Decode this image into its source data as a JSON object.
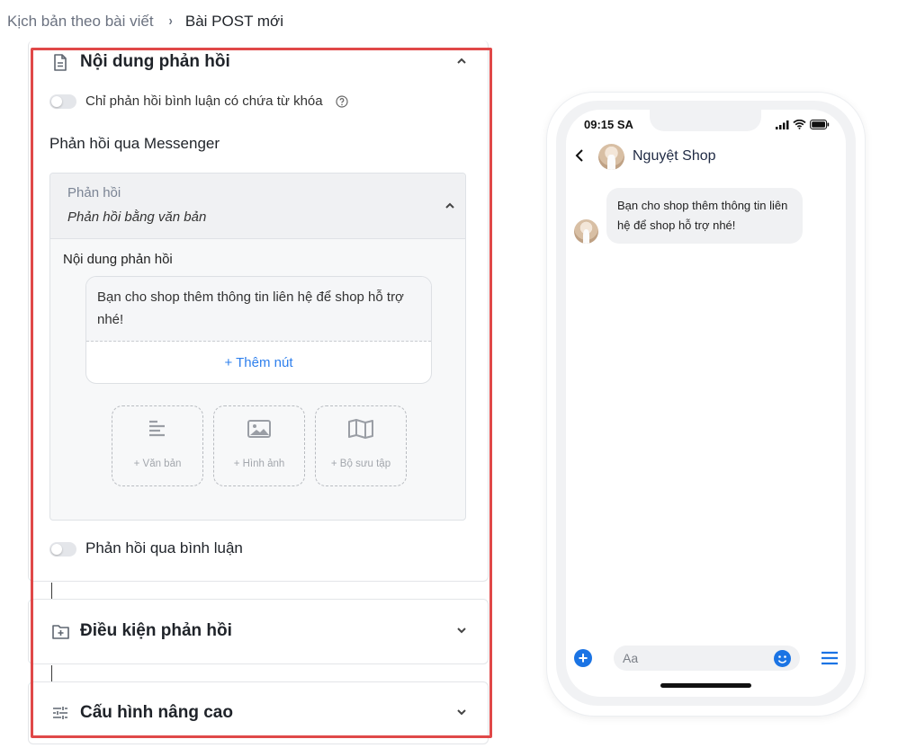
{
  "breadcrumb": {
    "parent": "Kịch bản theo bài viết",
    "separator": "›",
    "current": "Bài POST mới"
  },
  "section_response": {
    "title": "Nội dung phản hồi",
    "keyword_toggle_label": "Chỉ phản hồi bình luận có chứa từ khóa",
    "keyword_toggle_on": false,
    "messenger_label": "Phản hồi qua Messenger",
    "response_header": "Phản hồi",
    "response_type": "Phản hồi bằng văn bản",
    "content_label": "Nội dung phản hồi",
    "message_text": "Bạn cho shop thêm thông tin liên hệ để shop hỗ trợ nhé!",
    "add_button": "+ Thêm nút",
    "tiles": [
      {
        "label": "+ Văn bản",
        "icon": "text-lines-icon"
      },
      {
        "label": "+ Hình ảnh",
        "icon": "image-icon"
      },
      {
        "label": "+ Bộ sưu tập",
        "icon": "map-gallery-icon"
      }
    ],
    "comment_toggle_label": "Phản hồi qua bình luận",
    "comment_toggle_on": false
  },
  "section_conditions": {
    "title": "Điều kiện phản hồi"
  },
  "section_advanced": {
    "title": "Cấu hình nâng cao"
  },
  "phone": {
    "time": "09:15 SA",
    "shop_name": "Nguyệt Shop",
    "bubble_text": "Bạn cho shop thêm thông tin liên hệ để shop hỗ trợ nhé!",
    "input_placeholder": "Aa"
  },
  "colors": {
    "accent": "#2f80ed",
    "highlight_border": "#e04848",
    "messenger_blue": "#1b74e4"
  }
}
